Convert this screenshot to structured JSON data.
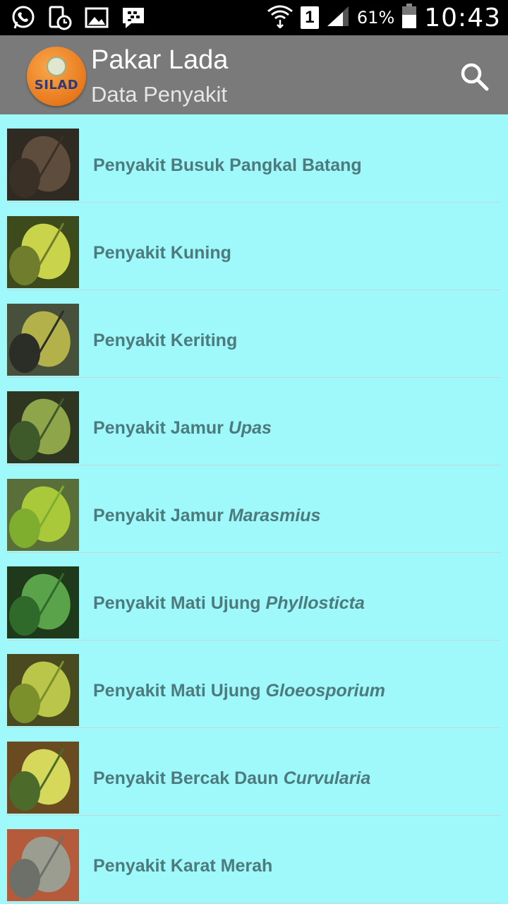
{
  "status_bar": {
    "battery": "61%",
    "sim_slot": "1",
    "time": "10:43",
    "icons": [
      "whatsapp-icon",
      "phone-schedule-icon",
      "gallery-icon",
      "bbm-icon",
      "wifi-icon",
      "signal-icon",
      "battery-icon"
    ]
  },
  "app_bar": {
    "logo_text": "SILAD",
    "title": "Pakar Lada",
    "subtitle": "Data Penyakit",
    "search_icon": "search-icon"
  },
  "diseases": [
    {
      "name": "Penyakit Busuk Pangkal Batang",
      "italic": ""
    },
    {
      "name": "Penyakit Kuning",
      "italic": ""
    },
    {
      "name": "Penyakit Keriting",
      "italic": ""
    },
    {
      "name": "Penyakit Jamur",
      "italic": "Upas"
    },
    {
      "name": "Penyakit Jamur",
      "italic": "Marasmius"
    },
    {
      "name": "Penyakit Mati Ujung",
      "italic": "Phyllosticta"
    },
    {
      "name": "Penyakit Mati Ujung",
      "italic": "Gloeosporium"
    },
    {
      "name": "Penyakit Bercak Daun",
      "italic": "Curvularia"
    },
    {
      "name": "Penyakit Karat Merah",
      "italic": ""
    }
  ],
  "colors": {
    "list_background": "#9ff8fa",
    "label_text": "#4d7a7c",
    "action_bar": "#7a7a7a"
  }
}
